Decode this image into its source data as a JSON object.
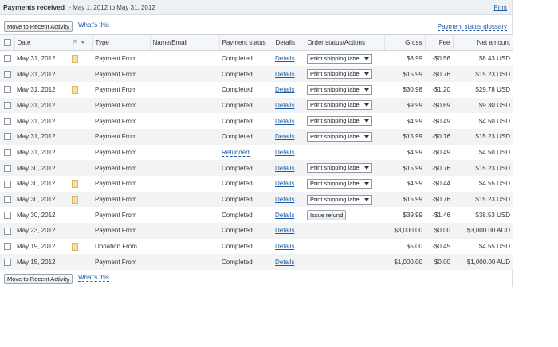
{
  "header": {
    "title": "Payments received",
    "range": "- May 1, 2012 to May 31, 2012",
    "print": "Print"
  },
  "actions": {
    "move_button": "Move to Recent Activity",
    "whats_this": "What's this",
    "glossary": "Payment status glossary"
  },
  "columns": {
    "date": "Date",
    "type": "Type",
    "name_email": "Name/Email",
    "payment_status": "Payment status",
    "details": "Details",
    "order_status": "Order status/Actions",
    "gross": "Gross",
    "fee": "Fee",
    "net": "Net amount"
  },
  "rows": [
    {
      "date": "May 31, 2012",
      "note": true,
      "type": "Payment From",
      "status": "Completed",
      "details": "Details",
      "action": "Print shipping label",
      "gross": "$8.99",
      "fee": "-$0.56",
      "net": "$8.43 USD"
    },
    {
      "date": "May 31, 2012",
      "note": false,
      "type": "Payment From",
      "status": "Completed",
      "details": "Details",
      "action": "Print shipping label",
      "gross": "$15.99",
      "fee": "-$0.76",
      "net": "$15.23 USD"
    },
    {
      "date": "May 31, 2012",
      "note": true,
      "type": "Payment From",
      "status": "Completed",
      "details": "Details",
      "action": "Print shipping label",
      "gross": "$30.98",
      "fee": "-$1.20",
      "net": "$29.78 USD"
    },
    {
      "date": "May 31, 2012",
      "note": false,
      "type": "Payment From",
      "status": "Completed",
      "details": "Details",
      "action": "Print shipping label",
      "gross": "$9.99",
      "fee": "-$0.69",
      "net": "$9.30 USD"
    },
    {
      "date": "May 31, 2012",
      "note": false,
      "type": "Payment From",
      "status": "Completed",
      "details": "Details",
      "action": "Print shipping label",
      "gross": "$4.99",
      "fee": "-$0.49",
      "net": "$4.50 USD"
    },
    {
      "date": "May 31, 2012",
      "note": false,
      "type": "Payment From",
      "status": "Completed",
      "details": "Details",
      "action": "Print shipping label",
      "gross": "$15.99",
      "fee": "-$0.76",
      "net": "$15.23 USD"
    },
    {
      "date": "May 31, 2012",
      "note": false,
      "type": "Payment From",
      "status": "Refunded",
      "details": "Details",
      "action": "",
      "gross": "$4.99",
      "fee": "-$0.49",
      "net": "$4.50 USD"
    },
    {
      "date": "May 30, 2012",
      "note": false,
      "type": "Payment From",
      "status": "Completed",
      "details": "Details",
      "action": "Print shipping label",
      "gross": "$15.99",
      "fee": "-$0.76",
      "net": "$15.23 USD"
    },
    {
      "date": "May 30, 2012",
      "note": true,
      "type": "Payment From",
      "status": "Completed",
      "details": "Details",
      "action": "Print shipping label",
      "gross": "$4.99",
      "fee": "-$0.44",
      "net": "$4.55 USD"
    },
    {
      "date": "May 30, 2012",
      "note": true,
      "type": "Payment From",
      "status": "Completed",
      "details": "Details",
      "action": "Print shipping label",
      "gross": "$15.99",
      "fee": "-$0.76",
      "net": "$15.23 USD"
    },
    {
      "date": "May 30, 2012",
      "note": false,
      "type": "Payment From",
      "status": "Completed",
      "details": "Details",
      "action": "Issue refund",
      "gross": "$39.99",
      "fee": "-$1.46",
      "net": "$38.53 USD"
    },
    {
      "date": "May 23, 2012",
      "note": false,
      "type": "Payment From",
      "status": "Completed",
      "details": "Details",
      "action": "",
      "gross": "$3,000.00",
      "fee": "$0.00",
      "net": "$3,000.00 AUD"
    },
    {
      "date": "May 19, 2012",
      "note": true,
      "type": "Donation From",
      "status": "Completed",
      "details": "Details",
      "action": "",
      "gross": "$5.00",
      "fee": "-$0.45",
      "net": "$4.55 USD"
    },
    {
      "date": "May 15, 2012",
      "note": false,
      "type": "Payment From",
      "status": "Completed",
      "details": "Details",
      "action": "",
      "gross": "$1,000.00",
      "fee": "$0.00",
      "net": "$1,000.00 AUD"
    }
  ],
  "colors": {
    "link": "#1f5aa6",
    "row_alt": "#f1f3f5",
    "header_bg": "#eef1f4"
  }
}
